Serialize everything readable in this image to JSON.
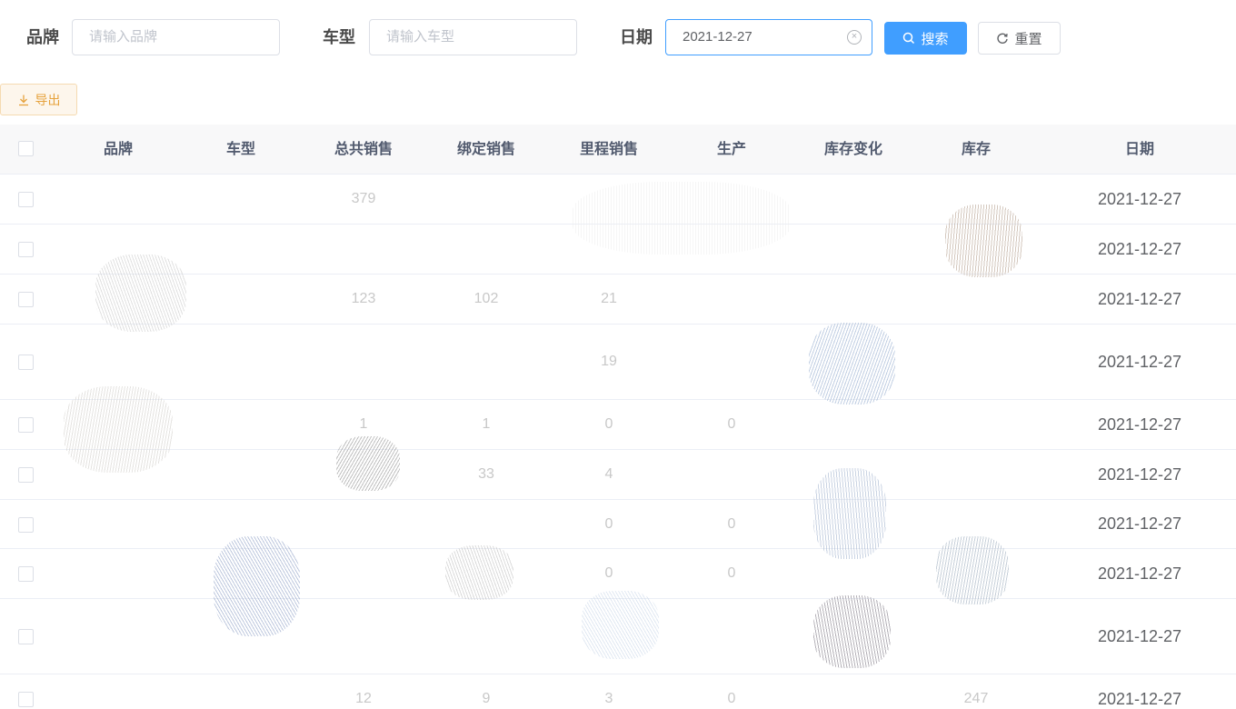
{
  "filters": {
    "brand_label": "品牌",
    "brand_placeholder": "请输入品牌",
    "model_label": "车型",
    "model_placeholder": "请输入车型",
    "date_label": "日期",
    "date_value": "2021-12-27",
    "search_label": "搜索",
    "reset_label": "重置"
  },
  "export_label": "导出",
  "table": {
    "headers": [
      "品牌",
      "车型",
      "总共销售",
      "绑定销售",
      "里程销售",
      "生产",
      "库存变化",
      "库存",
      "日期"
    ],
    "rows": [
      {
        "brand": "",
        "model": "",
        "total": "379",
        "bound": "",
        "mileage": "",
        "production": "",
        "change": "",
        "stock": "",
        "date": "2021-12-27"
      },
      {
        "brand": "",
        "model": "",
        "total": "",
        "bound": "",
        "mileage": "",
        "production": "",
        "change": "",
        "stock": "",
        "date": "2021-12-27"
      },
      {
        "brand": "",
        "model": "",
        "total": "123",
        "bound": "102",
        "mileage": "21",
        "production": "",
        "change": "",
        "stock": "",
        "date": "2021-12-27"
      },
      {
        "brand": "",
        "model": "",
        "total": "",
        "bound": "",
        "mileage": "19",
        "production": "",
        "change": "",
        "stock": "",
        "date": "2021-12-27"
      },
      {
        "brand": "",
        "model": "",
        "total": "1",
        "bound": "1",
        "mileage": "0",
        "production": "0",
        "change": "",
        "stock": "",
        "date": "2021-12-27"
      },
      {
        "brand": "",
        "model": "",
        "total": "",
        "bound": "33",
        "mileage": "4",
        "production": "",
        "change": "",
        "stock": "",
        "date": "2021-12-27"
      },
      {
        "brand": "",
        "model": "",
        "total": "",
        "bound": "",
        "mileage": "0",
        "production": "0",
        "change": "",
        "stock": "",
        "date": "2021-12-27"
      },
      {
        "brand": "",
        "model": "",
        "total": "",
        "bound": "",
        "mileage": "0",
        "production": "0",
        "change": "",
        "stock": "",
        "date": "2021-12-27"
      },
      {
        "brand": "",
        "model": "",
        "total": "",
        "bound": "",
        "mileage": "",
        "production": "",
        "change": "",
        "stock": "",
        "date": "2021-12-27"
      },
      {
        "brand": "",
        "model": "",
        "total": "12",
        "bound": "9",
        "mileage": "3",
        "production": "0",
        "change": "",
        "stock": "247",
        "date": "2021-12-27"
      }
    ]
  }
}
